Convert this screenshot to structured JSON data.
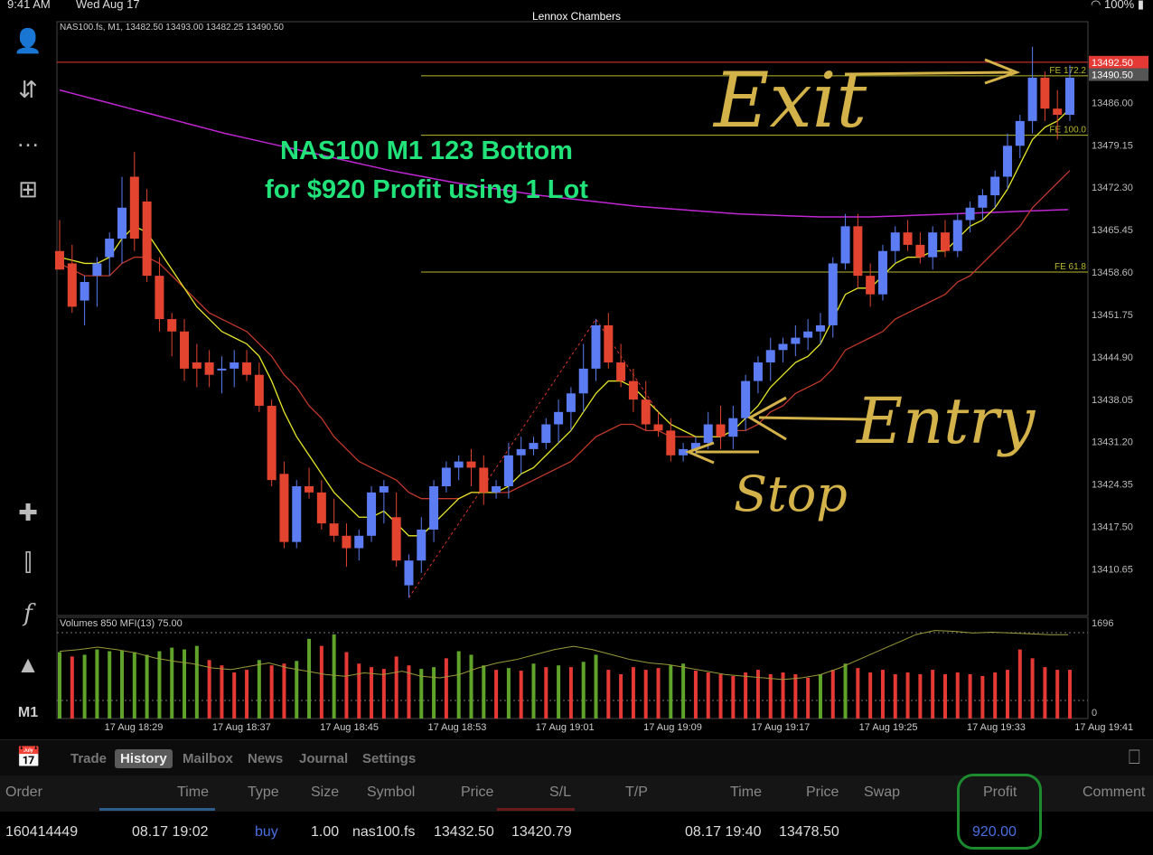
{
  "status": {
    "time": "9:41 AM",
    "date": "Wed Aug 17",
    "owner": "Lennox Chambers",
    "battery": "100%"
  },
  "sidebar": {
    "timeframe": "M1"
  },
  "chart_data": {
    "type": "candlestick",
    "header": "NAS100.fs, M1, 13482.50 13493.00 13482.25 13490.50",
    "annotation": [
      "NAS100 M1 123 Bottom",
      "for $920 Profit using 1 Lot"
    ],
    "handwritten": {
      "exit": "Exit",
      "entry": "Entry",
      "stop": "Stop"
    },
    "ylim": [
      13404,
      13497
    ],
    "yticks": [
      "13486.00",
      "13479.15",
      "13472.30",
      "13465.45",
      "13458.60",
      "13451.75",
      "13444.90",
      "13438.05",
      "13431.20",
      "13424.35",
      "13417.50",
      "13410.65"
    ],
    "price_labels": [
      {
        "value": 13492.5,
        "text": "13492.50",
        "color": "#e53935"
      },
      {
        "value": 13490.5,
        "text": "13490.50",
        "color": "#555555"
      }
    ],
    "fibo_levels": [
      {
        "label": "FE 172.2",
        "value": 13490.3
      },
      {
        "label": "FE 100.0",
        "value": 13480.7
      },
      {
        "label": "FE 61.8",
        "value": 13458.6
      }
    ],
    "xticks": [
      "17 Aug 18:29",
      "17 Aug 18:37",
      "17 Aug 18:45",
      "17 Aug 18:53",
      "17 Aug 19:01",
      "17 Aug 19:09",
      "17 Aug 19:17",
      "17 Aug 19:25",
      "17 Aug 19:33",
      "17 Aug 19:41"
    ],
    "candles": [
      [
        13462,
        13467,
        13460,
        13459
      ],
      [
        13460,
        13463,
        13452,
        13453
      ],
      [
        13454,
        13458,
        13450,
        13457
      ],
      [
        13458,
        13461,
        13453,
        13460
      ],
      [
        13461,
        13465,
        13458,
        13464
      ],
      [
        13464,
        13474,
        13460,
        13469
      ],
      [
        13474,
        13478,
        13462,
        13464
      ],
      [
        13470,
        13472,
        13457,
        13458
      ],
      [
        13458,
        13461,
        13449,
        13451
      ],
      [
        13451,
        13452,
        13445,
        13449
      ],
      [
        13449,
        13451,
        13441,
        13443
      ],
      [
        13444,
        13447,
        13440,
        13443
      ],
      [
        13444,
        13446,
        13440,
        13442
      ],
      [
        13443,
        13445,
        13439,
        13443
      ],
      [
        13443,
        13446,
        13440,
        13444
      ],
      [
        13444,
        13446,
        13441,
        13442
      ],
      [
        13442,
        13444,
        13436,
        13437
      ],
      [
        13437,
        13438,
        13424,
        13425
      ],
      [
        13426,
        13428,
        13414,
        13415
      ],
      [
        13415,
        13425,
        13414,
        13424
      ],
      [
        13424,
        13427,
        13422,
        13423
      ],
      [
        13423,
        13425,
        13417,
        13418
      ],
      [
        13418,
        13422,
        13415,
        13416
      ],
      [
        13416,
        13418,
        13411,
        13414
      ],
      [
        13414,
        13417,
        13412,
        13416
      ],
      [
        13416,
        13424,
        13415,
        13423
      ],
      [
        13423,
        13425,
        13418,
        13424
      ],
      [
        13419,
        13423,
        13411,
        13412
      ],
      [
        13408,
        13413,
        13406,
        13412
      ],
      [
        13412,
        13419,
        13410,
        13417
      ],
      [
        13417,
        13425,
        13415,
        13424
      ],
      [
        13424,
        13428,
        13423,
        13427
      ],
      [
        13427,
        13429,
        13425,
        13428
      ],
      [
        13428,
        13430,
        13424,
        13427
      ],
      [
        13427,
        13429,
        13421,
        13423
      ],
      [
        13423,
        13425,
        13422,
        13424
      ],
      [
        13424,
        13431,
        13422,
        13429
      ],
      [
        13429,
        13432,
        13426,
        13430
      ],
      [
        13430,
        13432,
        13429,
        13431
      ],
      [
        13431,
        13435,
        13430,
        13434
      ],
      [
        13434,
        13438,
        13431,
        13436
      ],
      [
        13436,
        13440,
        13433,
        13439
      ],
      [
        13439,
        13447,
        13436,
        13443
      ],
      [
        13443,
        13451,
        13441,
        13450
      ],
      [
        13450,
        13452,
        13443,
        13444
      ],
      [
        13444,
        13447,
        13440,
        13441
      ],
      [
        13441,
        13443,
        13436,
        13438
      ],
      [
        13438,
        13441,
        13433,
        13434
      ],
      [
        13434,
        13436,
        13432,
        13433
      ],
      [
        13433,
        13435,
        13428,
        13429
      ],
      [
        13429,
        13431,
        13428,
        13430
      ],
      [
        13430,
        13432,
        13429,
        13431
      ],
      [
        13431,
        13436,
        13430,
        13434
      ],
      [
        13434,
        13437,
        13430,
        13432
      ],
      [
        13432,
        13437,
        13430,
        13435
      ],
      [
        13435,
        13442,
        13433,
        13441
      ],
      [
        13441,
        13445,
        13439,
        13444
      ],
      [
        13444,
        13448,
        13441,
        13446
      ],
      [
        13446,
        13448,
        13444,
        13447
      ],
      [
        13447,
        13450,
        13445,
        13448
      ],
      [
        13448,
        13451,
        13446,
        13449
      ],
      [
        13449,
        13452,
        13447,
        13450
      ],
      [
        13450,
        13461,
        13448,
        13460
      ],
      [
        13460,
        13468,
        13459,
        13466
      ],
      [
        13466,
        13468,
        13456,
        13458
      ],
      [
        13458,
        13460,
        13453,
        13455
      ],
      [
        13455,
        13463,
        13454,
        13462
      ],
      [
        13462,
        13466,
        13460,
        13465
      ],
      [
        13465,
        13467,
        13462,
        13463
      ],
      [
        13463,
        13465,
        13460,
        13461
      ],
      [
        13461,
        13466,
        13459,
        13465
      ],
      [
        13465,
        13467,
        13461,
        13462
      ],
      [
        13462,
        13468,
        13461,
        13467
      ],
      [
        13467,
        13470,
        13465,
        13469
      ],
      [
        13469,
        13472,
        13467,
        13471
      ],
      [
        13471,
        13475,
        13469,
        13474
      ],
      [
        13474,
        13481,
        13472,
        13479
      ],
      [
        13479,
        13484,
        13477,
        13483
      ],
      [
        13483,
        13495,
        13481,
        13490
      ],
      [
        13490,
        13491,
        13483,
        13485
      ],
      [
        13485,
        13488,
        13480,
        13484
      ],
      [
        13484,
        13492,
        13483,
        13490
      ]
    ],
    "ema_fast": [
      13461,
      13460.5,
      13460,
      13460,
      13461,
      13464,
      13466,
      13465,
      13462,
      13459,
      13456,
      13453,
      13451,
      13449,
      13448,
      13447,
      13445,
      13441,
      13436,
      13432,
      13429,
      13426,
      13423,
      13421,
      13419,
      13419,
      13420,
      13418,
      13416,
      13416,
      13418,
      13420,
      13422,
      13423,
      13423,
      13423,
      13424,
      13426,
      13427,
      13429,
      13431,
      13433,
      13436,
      13439,
      13441,
      13441,
      13440,
      13438,
      13436,
      13434,
      13433,
      13432,
      13432,
      13432,
      13433,
      13435,
      13437,
      13440,
      13442,
      13444,
      13445,
      13447,
      13451,
      13455,
      13456,
      13456,
      13458,
      13460,
      13461,
      13461,
      13462,
      13462,
      13464,
      13466,
      13467,
      13469,
      13472,
      13476,
      13480,
      13482,
      13483,
      13485
    ],
    "ema_slow": [
      13460,
      13459,
      13458,
      13458,
      13458,
      13460,
      13461,
      13461,
      13460,
      13458,
      13456,
      13454,
      13452,
      13451,
      13450,
      13449,
      13447,
      13445,
      13442,
      13440,
      13437,
      13435,
      13432,
      13430,
      13428,
      13427,
      13426,
      13425,
      13423,
      13422,
      13422,
      13422,
      13422,
      13423,
      13423,
      13423,
      13423,
      13424,
      13425,
      13426,
      13427,
      13428,
      13430,
      13432,
      13433,
      13434,
      13434,
      13433,
      13433,
      13432,
      13432,
      13432,
      13432,
      13432,
      13433,
      13433,
      13434,
      13436,
      13437,
      13439,
      13440,
      13441,
      13443,
      13446,
      13447,
      13448,
      13449,
      13451,
      13452,
      13453,
      13454,
      13455,
      13457,
      13458,
      13460,
      13462,
      13464,
      13466,
      13469,
      13471,
      13473,
      13475
    ],
    "ma_purple": [
      13488,
      13487.3,
      13486.6,
      13485.9,
      13485.2,
      13484.5,
      13483.8,
      13483.1,
      13482.4,
      13481.7,
      13481,
      13480.4,
      13479.8,
      13479.2,
      13478.6,
      13478,
      13477.4,
      13476.8,
      13476.2,
      13475.6,
      13475,
      13474.5,
      13474,
      13473.5,
      13473,
      13472.6,
      13472.2,
      13471.8,
      13471.4,
      13471,
      13470.7,
      13470.4,
      13470.1,
      13469.8,
      13469.5,
      13469.2,
      13469,
      13468.8,
      13468.6,
      13468.4,
      13468.2,
      13468,
      13467.9,
      13467.8,
      13467.7,
      13467.6,
      13467.5,
      13467.5,
      13467.5,
      13467.5,
      13467.6,
      13467.7,
      13467.8,
      13467.9,
      13468,
      13468.1,
      13468.2,
      13468.3,
      13468.4,
      13468.5,
      13468.6,
      13468.7
    ],
    "volume_header": "Volumes 850 MFI(13) 75.00",
    "volume_scale": [
      "1696",
      "0"
    ],
    "volume": [
      [
        0.75,
        "g"
      ],
      [
        0.7,
        "r"
      ],
      [
        0.72,
        "g"
      ],
      [
        0.78,
        "g"
      ],
      [
        0.76,
        "g"
      ],
      [
        0.77,
        "g"
      ],
      [
        0.75,
        "g"
      ],
      [
        0.72,
        "g"
      ],
      [
        0.76,
        "g"
      ],
      [
        0.8,
        "g"
      ],
      [
        0.78,
        "g"
      ],
      [
        0.82,
        "g"
      ],
      [
        0.66,
        "r"
      ],
      [
        0.6,
        "r"
      ],
      [
        0.52,
        "r"
      ],
      [
        0.55,
        "r"
      ],
      [
        0.66,
        "g"
      ],
      [
        0.6,
        "r"
      ],
      [
        0.62,
        "r"
      ],
      [
        0.65,
        "g"
      ],
      [
        0.9,
        "g"
      ],
      [
        0.82,
        "r"
      ],
      [
        0.95,
        "g"
      ],
      [
        0.75,
        "r"
      ],
      [
        0.62,
        "r"
      ],
      [
        0.58,
        "r"
      ],
      [
        0.56,
        "r"
      ],
      [
        0.7,
        "r"
      ],
      [
        0.6,
        "r"
      ],
      [
        0.56,
        "g"
      ],
      [
        0.58,
        "g"
      ],
      [
        0.68,
        "r"
      ],
      [
        0.76,
        "g"
      ],
      [
        0.72,
        "g"
      ],
      [
        0.6,
        "g"
      ],
      [
        0.55,
        "r"
      ],
      [
        0.57,
        "g"
      ],
      [
        0.54,
        "r"
      ],
      [
        0.62,
        "g"
      ],
      [
        0.58,
        "r"
      ],
      [
        0.6,
        "g"
      ],
      [
        0.58,
        "r"
      ],
      [
        0.64,
        "g"
      ],
      [
        0.72,
        "g"
      ],
      [
        0.55,
        "r"
      ],
      [
        0.5,
        "r"
      ],
      [
        0.58,
        "r"
      ],
      [
        0.55,
        "r"
      ],
      [
        0.57,
        "r"
      ],
      [
        0.6,
        "g"
      ],
      [
        0.62,
        "g"
      ],
      [
        0.54,
        "r"
      ],
      [
        0.52,
        "r"
      ],
      [
        0.5,
        "r"
      ],
      [
        0.48,
        "r"
      ],
      [
        0.52,
        "r"
      ],
      [
        0.55,
        "r"
      ],
      [
        0.5,
        "r"
      ],
      [
        0.52,
        "r"
      ],
      [
        0.5,
        "r"
      ],
      [
        0.46,
        "r"
      ],
      [
        0.5,
        "g"
      ],
      [
        0.55,
        "r"
      ],
      [
        0.62,
        "g"
      ],
      [
        0.57,
        "r"
      ],
      [
        0.52,
        "r"
      ],
      [
        0.55,
        "r"
      ],
      [
        0.5,
        "r"
      ],
      [
        0.52,
        "r"
      ],
      [
        0.5,
        "r"
      ],
      [
        0.55,
        "r"
      ],
      [
        0.5,
        "r"
      ],
      [
        0.52,
        "r"
      ],
      [
        0.5,
        "r"
      ],
      [
        0.48,
        "r"
      ],
      [
        0.52,
        "r"
      ],
      [
        0.55,
        "r"
      ],
      [
        0.78,
        "r"
      ],
      [
        0.68,
        "r"
      ],
      [
        0.58,
        "r"
      ],
      [
        0.55,
        "r"
      ],
      [
        0.55,
        "r"
      ]
    ]
  },
  "tabs": [
    "Trade",
    "History",
    "Mailbox",
    "News",
    "Journal",
    "Settings"
  ],
  "active_tab": "History",
  "table": {
    "headers": {
      "order": "Order",
      "time": "Time",
      "type": "Type",
      "size": "Size",
      "symbol": "Symbol",
      "price": "Price",
      "sl": "S/L",
      "tp": "T/P",
      "time2": "Time",
      "price2": "Price",
      "swap": "Swap",
      "profit": "Profit",
      "comment": "Comment"
    },
    "row": {
      "order": "160414449",
      "time": "08.17 19:02",
      "type": "buy",
      "size": "1.00",
      "symbol": "nas100.fs",
      "price": "13432.50",
      "sl": "13420.79",
      "tp": "",
      "time2": "08.17 19:40",
      "price2": "13478.50",
      "swap": "",
      "profit": "920.00",
      "comment": ""
    }
  },
  "colors": {
    "bull": "#5b7cf2",
    "bear": "#e2442f",
    "ema_fast": "#e6e62a",
    "ema_slow": "#c0392b",
    "ma": "#c026d3",
    "fibo": "#b9b930",
    "annotation": "#21e37a",
    "hand": "#d4b24a",
    "vol_green": "#5fa32a",
    "vol_red": "#e53935"
  }
}
